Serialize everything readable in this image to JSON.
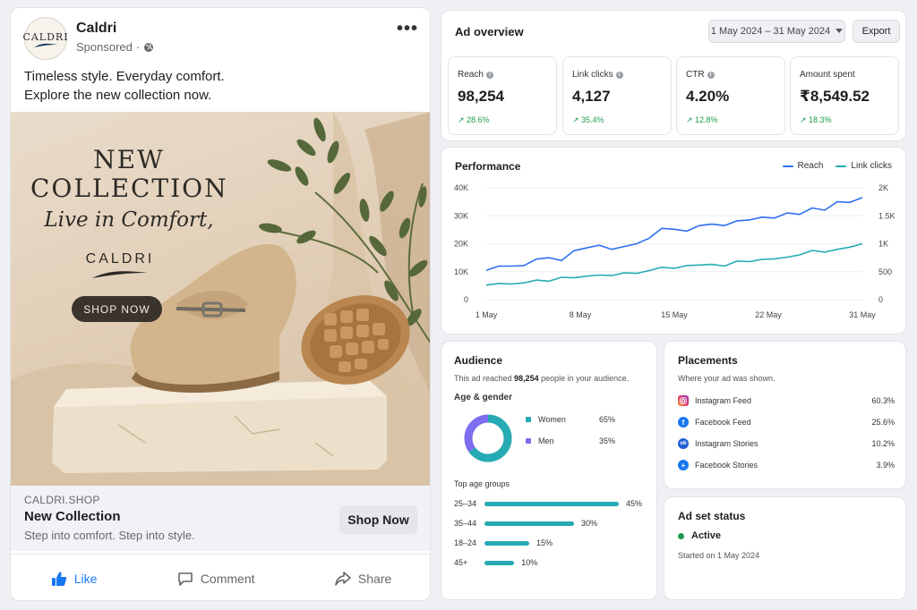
{
  "post": {
    "brand_name": "Caldri",
    "avatar_text": "CALDRI",
    "sponsored": "Sponsored",
    "text_line1": "Timeless style. Everyday comfort.",
    "text_line2": "Explore the new collection now.",
    "image": {
      "headline_line1": "NEW",
      "headline_line2": "COLLECTION",
      "script_text": "Live in Comfort,",
      "brand": "CALDRI",
      "cta": "SHOP NOW"
    },
    "link": {
      "domain": "CALDRI.SHOP",
      "title": "New Collection",
      "description": "Step into comfort. Step into style.",
      "button": "Shop Now"
    },
    "actions": {
      "like": "Like",
      "comment": "Comment",
      "share": "Share"
    }
  },
  "overview": {
    "title": "Ad overview",
    "date_range": "1 May 2024 – 31 May 2024",
    "export": "Export",
    "kpis": [
      {
        "label": "Reach",
        "value": "98,254",
        "change": "↗ 28.6%"
      },
      {
        "label": "Link clicks",
        "value": "4,127",
        "change": "↗ 35.4%"
      },
      {
        "label": "CTR",
        "value": "4.20%",
        "change": "↗ 12.8%"
      },
      {
        "label": "Amount spent",
        "value": "₹8,549.52",
        "change": "↗ 18.3%"
      }
    ]
  },
  "chart_data": {
    "type": "line",
    "title": "Performance",
    "x_ticks": [
      "1 May",
      "8 May",
      "15 May",
      "22 May",
      "31 May"
    ],
    "y_left_ticks": [
      "40K",
      "30K",
      "20K",
      "10K",
      "0"
    ],
    "y_right_ticks": [
      "2K",
      "1.5K",
      "1K",
      "500",
      "0"
    ],
    "y_left_lim": [
      0,
      40000
    ],
    "y_right_lim": [
      0,
      2000
    ],
    "series": [
      {
        "name": "Reach",
        "axis": "left",
        "color": "#2d6ff0",
        "values": [
          10500,
          12000,
          12000,
          12200,
          14500,
          15000,
          14000,
          17500,
          18500,
          19500,
          18000,
          19000,
          20000,
          22000,
          25500,
          25200,
          24500,
          26500,
          27000,
          26500,
          28200,
          28500,
          29500,
          29200,
          31000,
          30500,
          32800,
          32000,
          35000,
          34800,
          36500
        ]
      },
      {
        "name": "Link clicks",
        "axis": "right",
        "color": "#26aab4",
        "values": [
          260,
          290,
          280,
          300,
          350,
          330,
          400,
          390,
          420,
          440,
          430,
          480,
          470,
          520,
          580,
          560,
          610,
          620,
          630,
          600,
          690,
          680,
          720,
          730,
          760,
          800,
          880,
          850,
          900,
          940,
          1000
        ]
      }
    ]
  },
  "audience": {
    "title": "Audience",
    "reach_prefix": "This ad reached ",
    "reach_value": "98,254",
    "reach_suffix": " people in your audience.",
    "age_gender_label": "Age & gender",
    "gender": [
      {
        "label": "Women",
        "pct": "65%",
        "value": 65,
        "color": "#26aab4"
      },
      {
        "label": "Men",
        "pct": "35%",
        "value": 35,
        "color": "#7b6ef0"
      }
    ],
    "top_age_label": "Top age groups",
    "age_groups": [
      {
        "label": "25–34",
        "pct": "45%",
        "value": 45
      },
      {
        "label": "35–44",
        "pct": "30%",
        "value": 30
      },
      {
        "label": "18–24",
        "pct": "15%",
        "value": 15
      },
      {
        "label": "45+",
        "pct": "10%",
        "value": 10
      }
    ]
  },
  "placements": {
    "title": "Placements",
    "subtitle": "Where your ad was shown.",
    "items": [
      {
        "label": "Instagram Feed",
        "pct": "60.3%",
        "icon": "instagram-icon",
        "color": "#e1306c"
      },
      {
        "label": "Facebook Feed",
        "pct": "25.6%",
        "icon": "facebook-icon",
        "color": "#1877f2"
      },
      {
        "label": "Instagram Stories",
        "pct": "10.2%",
        "icon": "instagram-stories-icon",
        "color": "#1f5fd6"
      },
      {
        "label": "Facebook Stories",
        "pct": "3.9%",
        "icon": "facebook-stories-icon",
        "color": "#1877f2"
      }
    ]
  },
  "ad_set": {
    "title": "Ad set status",
    "status": "Active",
    "started": "Started on 1 May 2024"
  }
}
